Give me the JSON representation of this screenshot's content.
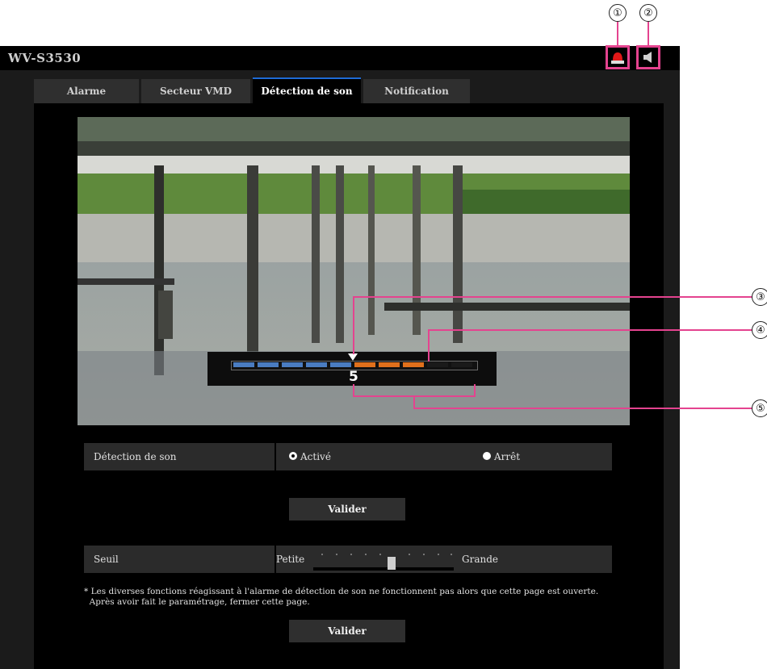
{
  "header": {
    "model": "WV-S3530"
  },
  "tabs": [
    {
      "label": "Alarme",
      "active": false
    },
    {
      "label": "Secteur VMD",
      "active": false
    },
    {
      "label": "Détection de son",
      "active": true
    },
    {
      "label": "Notification",
      "active": false
    }
  ],
  "callouts": [
    "①",
    "②",
    "③",
    "④",
    "⑤"
  ],
  "sound_meter": {
    "level_value": "5",
    "segments_total": 10,
    "segments_blue": 5,
    "segments_orange": 3,
    "threshold_position_segment": 5,
    "colors": {
      "blue": "#4a7cc1",
      "orange": "#e0701c",
      "empty": "#1a1a1a",
      "accent": "#e4438f"
    }
  },
  "form": {
    "detection_label": "Détection de son",
    "on_label": "Activé",
    "off_label": "Arrêt",
    "selected": "Activé",
    "apply_label_1": "Valider",
    "threshold_label": "Seuil",
    "threshold_min_label": "Petite",
    "threshold_max_label": "Grande",
    "threshold_level_fraction": 0.55,
    "note_line_1": "* Les diverses fonctions réagissant à l'alarme de détection de son ne fonctionnent pas alors que cette page est ouverte.",
    "note_line_2": "  Après avoir fait le paramétrage, fermer cette page.",
    "apply_label_2": "Valider"
  },
  "icons": [
    "alarm-status-icon",
    "speaker-icon"
  ]
}
